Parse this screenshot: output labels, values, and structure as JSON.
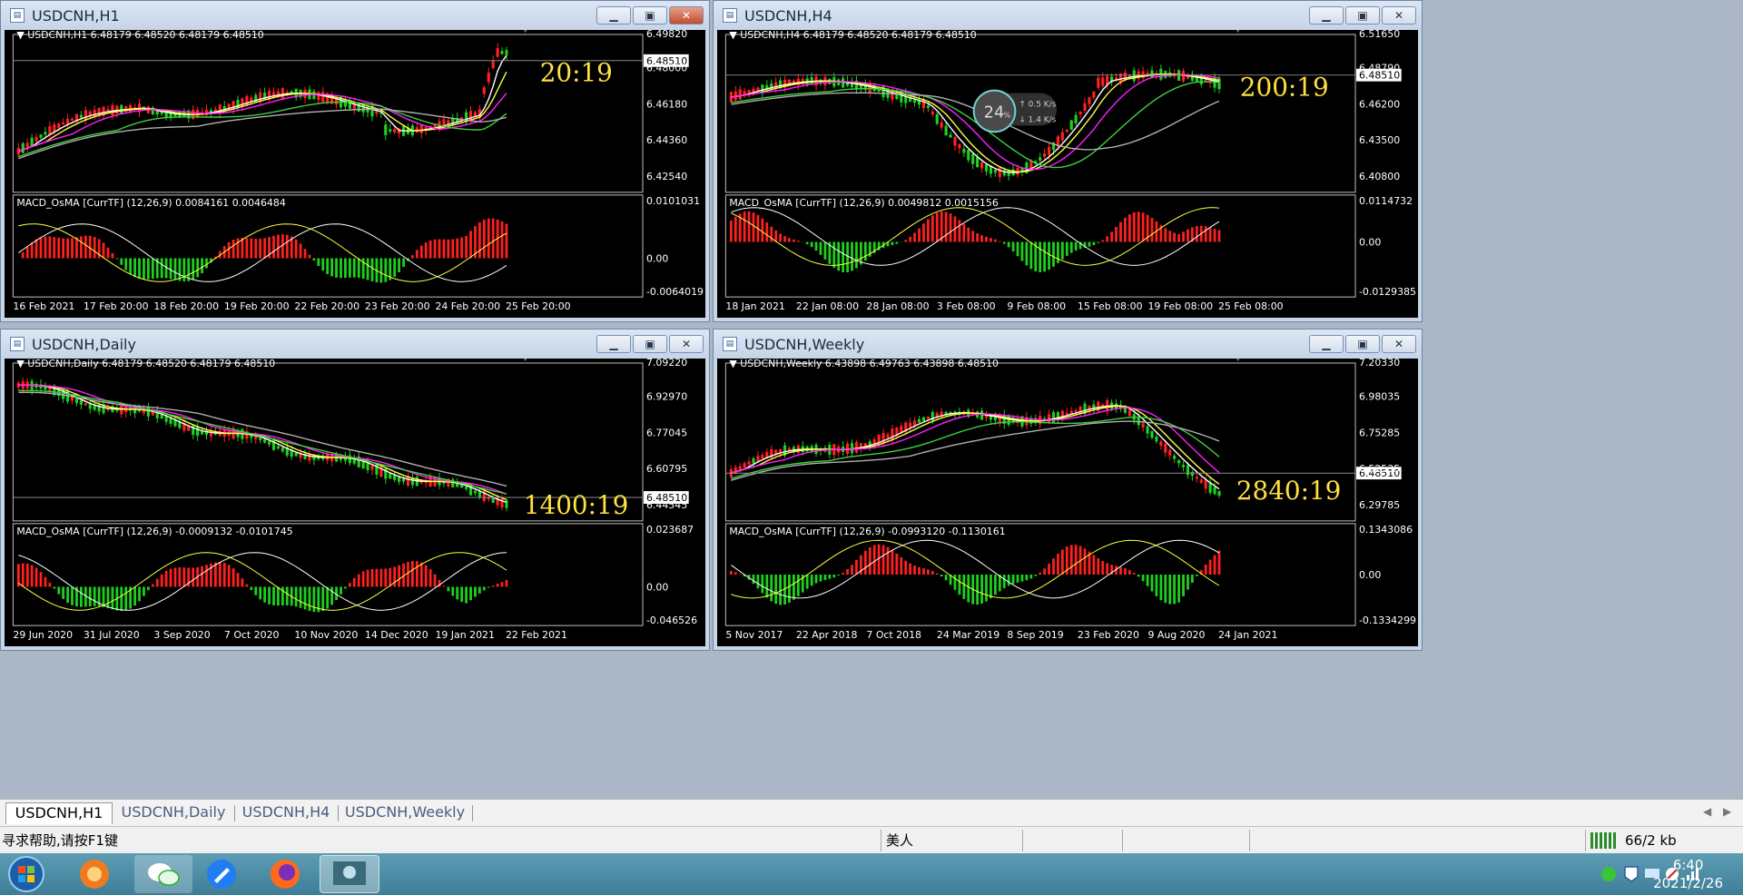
{
  "windows": [
    {
      "id": "h1",
      "title": "USDCNH,H1",
      "header": "USDCNH,H1  6.48179 6.48520 6.48179 6.48510",
      "prices": [
        "6.49820",
        "6.48000",
        "6.46180",
        "6.44360",
        "6.42540"
      ],
      "current_price": "6.48510",
      "countdown": "20:19",
      "macd_header": "MACD_OsMA [CurrTF] (12,26,9) 0.0084161 0.0046484",
      "macd_scale": [
        "0.0101031",
        "0.00",
        "-0.0064019"
      ],
      "dates": [
        "16 Feb 2021",
        "17 Feb 20:00",
        "18 Feb 20:00",
        "19 Feb 20:00",
        "22 Feb 20:00",
        "23 Feb 20:00",
        "24 Feb 20:00",
        "25 Feb 20:00"
      ],
      "active": true
    },
    {
      "id": "h4",
      "title": "USDCNH,H4",
      "header": "USDCNH,H4  6.48179 6.48520 6.48179 6.48510",
      "prices": [
        "6.51650",
        "6.48790",
        "6.46200",
        "6.43500",
        "6.40800"
      ],
      "current_price": "6.48510",
      "countdown": "200:19",
      "macd_header": "MACD_OsMA [CurrTF] (12,26,9) 0.0049812 0.0015156",
      "macd_scale": [
        "0.0114732",
        "0.00",
        "-0.0129385"
      ],
      "dates": [
        "18 Jan 2021",
        "22 Jan 08:00",
        "28 Jan 08:00",
        "3 Feb 08:00",
        "9 Feb 08:00",
        "15 Feb 08:00",
        "19 Feb 08:00",
        "25 Feb 08:00"
      ],
      "active": false,
      "overlay": {
        "percent": "24",
        "percent_unit": "%",
        "up": "0.5",
        "down": "1.4",
        "speed_unit": "K/s"
      }
    },
    {
      "id": "daily",
      "title": "USDCNH,Daily",
      "header": "USDCNH,Daily  6.48179 6.48520 6.48179 6.48510",
      "prices": [
        "7.09220",
        "6.92970",
        "6.77045",
        "6.60795",
        "6.44545"
      ],
      "current_price": "6.48510",
      "countdown": "1400:19",
      "macd_header": "MACD_OsMA [CurrTF] (12,26,9) -0.0009132 -0.0101745",
      "macd_scale": [
        "0.023687",
        "0.00",
        "-0.046526"
      ],
      "dates": [
        "29 Jun 2020",
        "31 Jul 2020",
        "3 Sep 2020",
        "7 Oct 2020",
        "10 Nov 2020",
        "14 Dec 2020",
        "19 Jan 2021",
        "22 Feb 2021"
      ],
      "active": false
    },
    {
      "id": "weekly",
      "title": "USDCNH,Weekly",
      "header": "USDCNH,Weekly  6.43898 6.49763 6.43898 6.48510",
      "prices": [
        "7.20330",
        "6.98035",
        "6.75285",
        "6.52535",
        "6.29785"
      ],
      "current_price": "6.48510",
      "countdown": "2840:19",
      "macd_header": "MACD_OsMA [CurrTF] (12,26,9) -0.0993120 -0.1130161",
      "macd_scale": [
        "0.1343086",
        "0.00",
        "-0.1334299"
      ],
      "dates": [
        "5 Nov 2017",
        "22 Apr 2018",
        "7 Oct 2018",
        "24 Mar 2019",
        "8 Sep 2019",
        "23 Feb 2020",
        "9 Aug 2020",
        "24 Jan 2021"
      ],
      "active": false
    }
  ],
  "tabs": [
    "USDCNH,H1",
    "USDCNH,Daily",
    "USDCNH,H4",
    "USDCNH,Weekly"
  ],
  "status": {
    "help": "寻求帮助,请按F1键",
    "profile": "美人",
    "traffic": "66/2 kb"
  },
  "clock": {
    "time": "6:40",
    "date": "2021/2/26"
  },
  "taskbar_apps": [
    "start-orb",
    "app-fox",
    "wechat",
    "feishu",
    "firefox",
    "metatrader"
  ],
  "colors": {
    "bull": "#ff2020",
    "bear": "#1ed01e",
    "ma_white": "#ffffff",
    "ma_yellow": "#ffff40",
    "ma_magenta": "#ff20ff",
    "ma_green": "#40d040",
    "ma_gray": "#b0b0b0",
    "countdown": "#ffe040"
  }
}
